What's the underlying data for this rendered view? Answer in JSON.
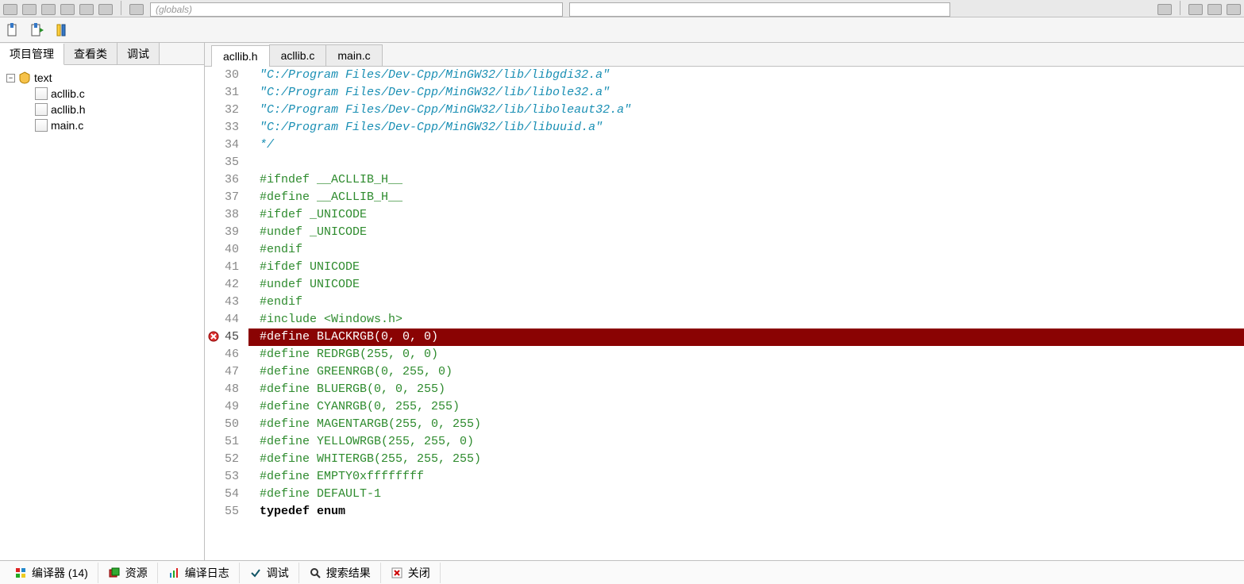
{
  "topbar": {
    "globals_hint": "(globals)"
  },
  "sidebar": {
    "tabs": [
      {
        "id": "project",
        "label": "项目管理",
        "active": true
      },
      {
        "id": "classes",
        "label": "查看类",
        "active": false
      },
      {
        "id": "debug",
        "label": "调试",
        "active": false
      }
    ],
    "tree": {
      "root": {
        "label": "text",
        "expanded": true
      },
      "files": [
        {
          "label": "acllib.c"
        },
        {
          "label": "acllib.h"
        },
        {
          "label": "main.c"
        }
      ]
    }
  },
  "editor": {
    "tabs": [
      {
        "id": "acllib_h",
        "label": "acllib.h",
        "active": true
      },
      {
        "id": "acllib_c",
        "label": "acllib.c",
        "active": false
      },
      {
        "id": "main_c",
        "label": "main.c",
        "active": false
      }
    ],
    "first_line_number": 30,
    "error_line_number": 45,
    "lines": [
      {
        "n": 30,
        "cls": "comment",
        "text": "\"C:/Program Files/Dev-Cpp/MinGW32/lib/libgdi32.a\""
      },
      {
        "n": 31,
        "cls": "comment",
        "text": "\"C:/Program Files/Dev-Cpp/MinGW32/lib/libole32.a\""
      },
      {
        "n": 32,
        "cls": "comment",
        "text": "\"C:/Program Files/Dev-Cpp/MinGW32/lib/liboleaut32.a\""
      },
      {
        "n": 33,
        "cls": "comment",
        "text": "\"C:/Program Files/Dev-Cpp/MinGW32/lib/libuuid.a\""
      },
      {
        "n": 34,
        "cls": "comment",
        "text": "*/"
      },
      {
        "n": 35,
        "cls": "",
        "text": ""
      },
      {
        "n": 36,
        "cls": "pre",
        "text": "#ifndef __ACLLIB_H__"
      },
      {
        "n": 37,
        "cls": "pre",
        "text": "#define __ACLLIB_H__"
      },
      {
        "n": 38,
        "cls": "pre",
        "text": "#ifdef _UNICODE"
      },
      {
        "n": 39,
        "cls": "pre",
        "text": "#undef _UNICODE"
      },
      {
        "n": 40,
        "cls": "pre",
        "text": "#endif"
      },
      {
        "n": 41,
        "cls": "pre",
        "text": "#ifdef UNICODE"
      },
      {
        "n": 42,
        "cls": "pre",
        "text": "#undef UNICODE"
      },
      {
        "n": 43,
        "cls": "pre",
        "text": "#endif"
      },
      {
        "n": 44,
        "cls": "pre",
        "text": "#include <Windows.h>"
      },
      {
        "n": 45,
        "cls": "error",
        "text": "#define BLACKRGB(0, 0, 0)"
      },
      {
        "n": 46,
        "cls": "pre",
        "text": "#define REDRGB(255, 0, 0)"
      },
      {
        "n": 47,
        "cls": "pre",
        "text": "#define GREENRGB(0, 255, 0)"
      },
      {
        "n": 48,
        "cls": "pre",
        "text": "#define BLUERGB(0, 0, 255)"
      },
      {
        "n": 49,
        "cls": "pre",
        "text": "#define CYANRGB(0, 255, 255)"
      },
      {
        "n": 50,
        "cls": "pre",
        "text": "#define MAGENTARGB(255, 0, 255)"
      },
      {
        "n": 51,
        "cls": "pre",
        "text": "#define YELLOWRGB(255, 255, 0)"
      },
      {
        "n": 52,
        "cls": "pre",
        "text": "#define WHITERGB(255, 255, 255)"
      },
      {
        "n": 53,
        "cls": "pre",
        "text": "#define EMPTY0xffffffff"
      },
      {
        "n": 54,
        "cls": "pre",
        "text": "#define DEFAULT-1"
      },
      {
        "n": 55,
        "cls": "kw",
        "text": "typedef enum"
      }
    ]
  },
  "bottom_tabs": [
    {
      "id": "compiler",
      "label": "编译器 (14)",
      "icon": "grid-icon"
    },
    {
      "id": "resources",
      "label": "资源",
      "icon": "stack-icon"
    },
    {
      "id": "log",
      "label": "编译日志",
      "icon": "bars-icon"
    },
    {
      "id": "debug",
      "label": "调试",
      "icon": "check-icon"
    },
    {
      "id": "search",
      "label": "搜索结果",
      "icon": "search-icon"
    },
    {
      "id": "close",
      "label": "关闭",
      "icon": "close-icon"
    }
  ]
}
